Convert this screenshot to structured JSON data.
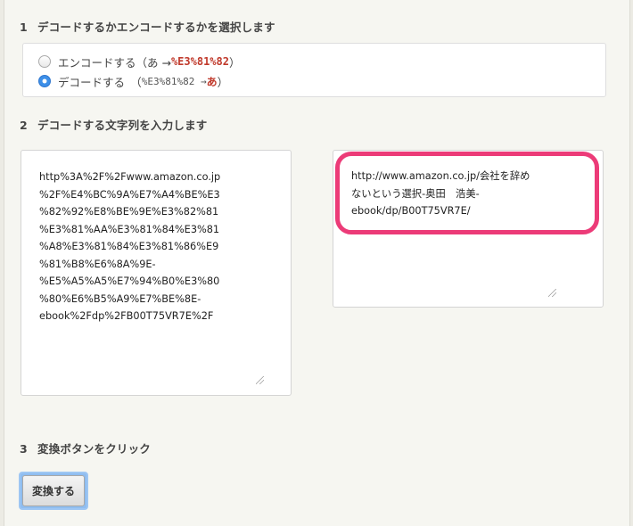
{
  "step1": {
    "number": "1",
    "title": "デコードするかエンコードするかを選択します",
    "options": [
      {
        "label": "エンコードする（あ → ",
        "code": "%E3%81%82",
        "suffix": "）",
        "selected": false
      },
      {
        "label": "デコードする　（",
        "code": "%E3%81%82 → ",
        "result": "あ",
        "suffix": "）",
        "selected": true
      }
    ]
  },
  "step2": {
    "number": "2",
    "title": "デコードする文字列を入力します",
    "input_text": "http%3A%2F%2Fwww.amazon.co.jp\n%2F%E4%BC%9A%E7%A4%BE%E3\n%82%92%E8%BE%9E%E3%82%81\n%E3%81%AA%E3%81%84%E3%81\n%A8%E3%81%84%E3%81%86%E9\n%81%B8%E6%8A%9E-\n%E5%A5%A5%E7%94%B0%E3%80\n%80%E6%B5%A9%E7%BE%8E-\nebook%2Fdp%2FB00T75VR7E%2F",
    "output_text": "http://www.amazon.co.jp/会社を辞め\nないという選択-奥田　浩美-\nebook/dp/B00T75VR7E/",
    "highlight_color": "#ec3b78"
  },
  "step3": {
    "number": "3",
    "title": "変換ボタンをクリック",
    "button_label": "変換する"
  }
}
